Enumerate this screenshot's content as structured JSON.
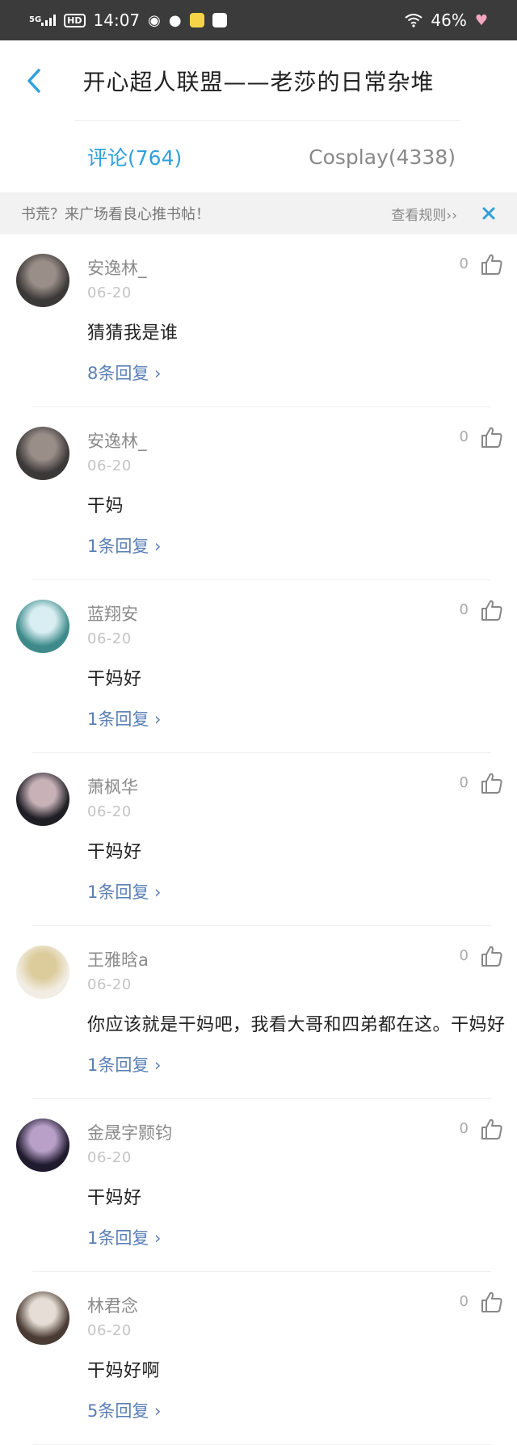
{
  "status_bar": {
    "network": "5G",
    "hd": "HD",
    "time": "14:07",
    "battery": "46%"
  },
  "nav": {
    "title": "开心超人联盟——老莎的日常杂堆"
  },
  "tabs": [
    {
      "label": "评论(764)",
      "active": true
    },
    {
      "label": "Cosplay(4338)",
      "active": false
    }
  ],
  "notice": {
    "text": "书荒？来广场看良心推书帖！",
    "rules": "查看规则››"
  },
  "comments": [
    {
      "author": "安逸林_",
      "date": "06-20",
      "text": "猜猜我是谁",
      "replies": "8条回复 ›",
      "likes": "0",
      "avatar_colors": [
        "#3b3838",
        "#9a8e88"
      ]
    },
    {
      "author": "安逸林_",
      "date": "06-20",
      "text": "干妈",
      "replies": "1条回复 ›",
      "likes": "0",
      "avatar_colors": [
        "#3b3838",
        "#9a8e88"
      ]
    },
    {
      "author": "蓝翔安",
      "date": "06-20",
      "text": "干妈好",
      "replies": "1条回复 ›",
      "likes": "0",
      "avatar_colors": [
        "#3e8a8a",
        "#d8eef2"
      ]
    },
    {
      "author": "萧枫华",
      "date": "06-20",
      "text": "干妈好",
      "replies": "1条回复 ›",
      "likes": "0",
      "avatar_colors": [
        "#1e1e24",
        "#c8b2b8"
      ]
    },
    {
      "author": "王雅晗a",
      "date": "06-20",
      "text": "你应该就是干妈吧，我看大哥和四弟都在这。干妈好",
      "replies": "1条回复 ›",
      "likes": "0",
      "avatar_colors": [
        "#f2ede4",
        "#dccc9c"
      ]
    },
    {
      "author": "金晟字颢钧",
      "date": "06-20",
      "text": "干妈好",
      "replies": "1条回复 ›",
      "likes": "0",
      "avatar_colors": [
        "#1f1a2e",
        "#b8a0c8"
      ]
    },
    {
      "author": "林君念",
      "date": "06-20",
      "text": "干妈好啊",
      "replies": "5条回复 ›",
      "likes": "0",
      "avatar_colors": [
        "#4a3c34",
        "#e6ded6"
      ]
    }
  ]
}
